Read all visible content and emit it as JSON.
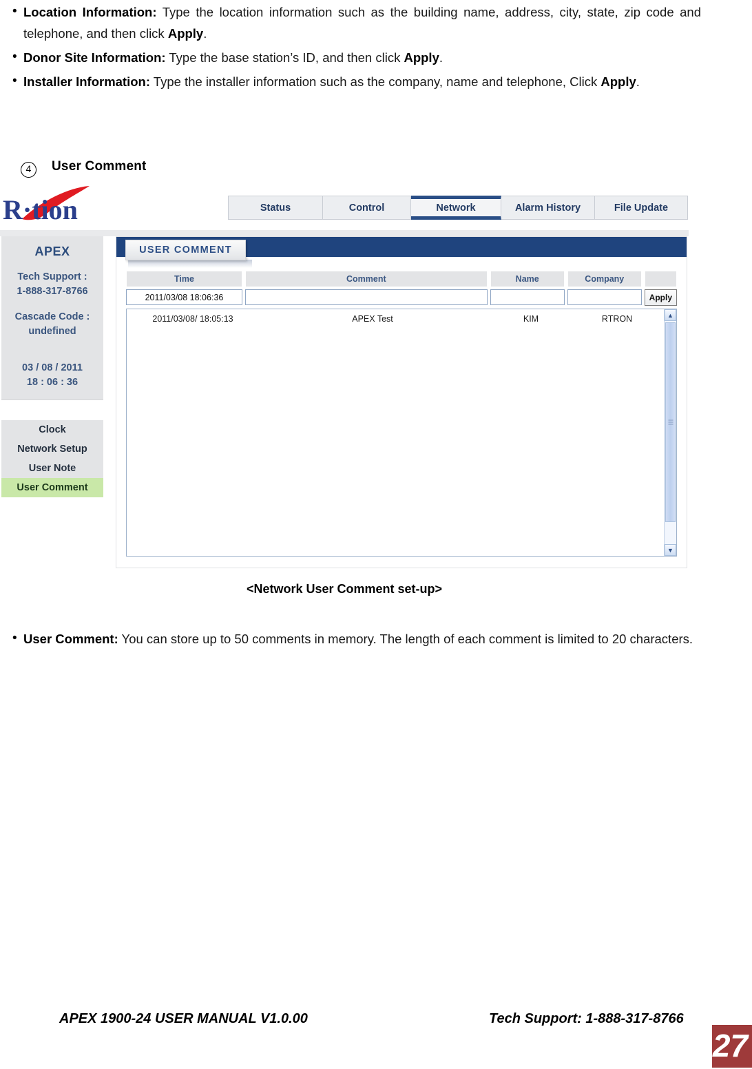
{
  "document": {
    "bullets": [
      {
        "label": "Location Information:",
        "text": " Type the location information such as the building name, address, city, state, zip code and telephone, and then click ",
        "label2": "Apply",
        "tail": "."
      },
      {
        "label": "Donor Site Information:",
        "text": " Type the base station’s ID, and then click ",
        "label2": "Apply",
        "tail": "."
      },
      {
        "label": "Installer  Information:",
        "text": "  Type   the   installer   information   such   as   the   company,   name   and telephone, Click ",
        "label2": "Apply",
        "tail": "."
      }
    ],
    "section": {
      "number": "④",
      "title": "User Comment"
    },
    "caption": "<Network User Comment set-up>",
    "lower_bullet": {
      "label": "User Comment:",
      "text": " You can store up to 50 comments in memory. The length of each comment is limited to 20 characters."
    }
  },
  "screenshot": {
    "logo": {
      "text": "R·tion",
      "text_color": "#2b3f8c",
      "swoosh_color": "#e01b22",
      "icon": "rtion-logo"
    },
    "top_tabs": [
      {
        "label": "Status",
        "active": false
      },
      {
        "label": "Control",
        "active": false
      },
      {
        "label": "Network",
        "active": true
      },
      {
        "label": "Alarm History",
        "active": false
      },
      {
        "label": "File Update",
        "active": false
      }
    ],
    "sidebar": {
      "device_name": "APEX",
      "tech_support_label": "Tech Support :",
      "tech_support_value": "1-888-317-8766",
      "cascade_label": "Cascade Code :",
      "cascade_value": "undefined",
      "date": "03 / 08 / 2011",
      "time": "18 : 06 : 36",
      "menu": [
        {
          "label": "Clock",
          "active": false
        },
        {
          "label": "Network Setup",
          "active": false
        },
        {
          "label": "User Note",
          "active": false
        },
        {
          "label": "User Comment",
          "active": true
        }
      ]
    },
    "panel": {
      "tab_label": "USER COMMENT",
      "header_color": "#1f447e",
      "table": {
        "headers": [
          "Time",
          "Comment",
          "Name",
          "Company",
          ""
        ],
        "form_row": {
          "time_value": "2011/03/08 18:06:36",
          "comment_value": "",
          "name_value": "",
          "company_value": "",
          "apply_label": "Apply"
        },
        "rows": [
          {
            "time": "2011/03/08/ 18:05:13",
            "comment": "APEX Test",
            "name": "KIM",
            "company": "RTRON"
          }
        ]
      },
      "scrollbar": {
        "up_arrow": "▲",
        "down_arrow": "▼"
      }
    }
  },
  "footer": {
    "left": "APEX 1900-24 USER MANUAL V1.0.00",
    "right": "Tech Support: 1-888-317-8766",
    "page_number": "27",
    "page_block_color": "#9e3a3a"
  }
}
